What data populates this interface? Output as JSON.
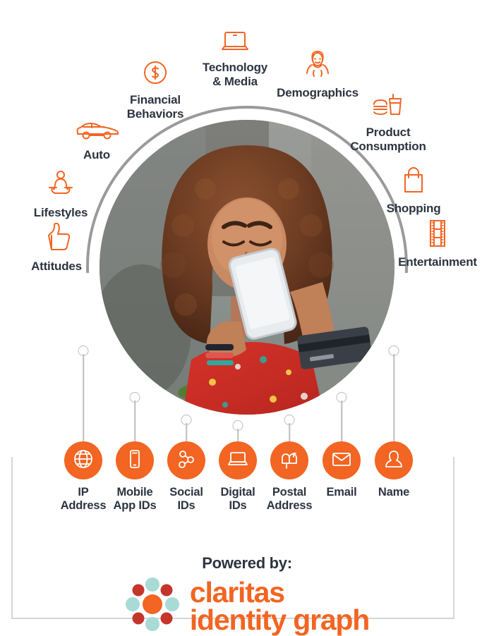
{
  "theme": {
    "orange": "#F26522",
    "text_dark": "#2c3440",
    "arc_gray": "#9a9a9a",
    "bracket_gray": "#d6d6d6",
    "logo_teal": "#A8DAD6",
    "logo_red": "#C4352B"
  },
  "attributes": [
    {
      "label": "Financial\nBehaviors",
      "icon": "dollar-circle-icon"
    },
    {
      "label": "Technology\n& Media",
      "icon": "laptop-icon"
    },
    {
      "label": "Demographics",
      "icon": "person-female-icon"
    },
    {
      "label": "Product\nConsumption",
      "icon": "burger-drink-icon"
    },
    {
      "label": "Auto",
      "icon": "car-icon"
    },
    {
      "label": "Shopping",
      "icon": "shopping-bag-icon"
    },
    {
      "label": "Lifestyles",
      "icon": "yoga-icon"
    },
    {
      "label": "Entertainment",
      "icon": "film-strip-icon"
    },
    {
      "label": "Attitudes",
      "icon": "thumbs-up-icon"
    }
  ],
  "identifiers": [
    {
      "label": "IP\nAddress",
      "icon": "globe-icon"
    },
    {
      "label": "Mobile\nApp IDs",
      "icon": "mobile-phone-icon"
    },
    {
      "label": "Social\nIDs",
      "icon": "share-nodes-icon"
    },
    {
      "label": "Digital\nIDs",
      "icon": "laptop-icon"
    },
    {
      "label": "Postal\nAddress",
      "icon": "mailbox-icon"
    },
    {
      "label": "Email",
      "icon": "envelope-icon"
    },
    {
      "label": "Name",
      "icon": "person-silhouette-icon"
    }
  ],
  "footer": {
    "powered_by": "Powered by:",
    "brand_line1": "claritas",
    "brand_line2": "identity graph"
  },
  "photo": {
    "alt": "Smiling woman with curly hair holding a smartphone and a credit card"
  }
}
